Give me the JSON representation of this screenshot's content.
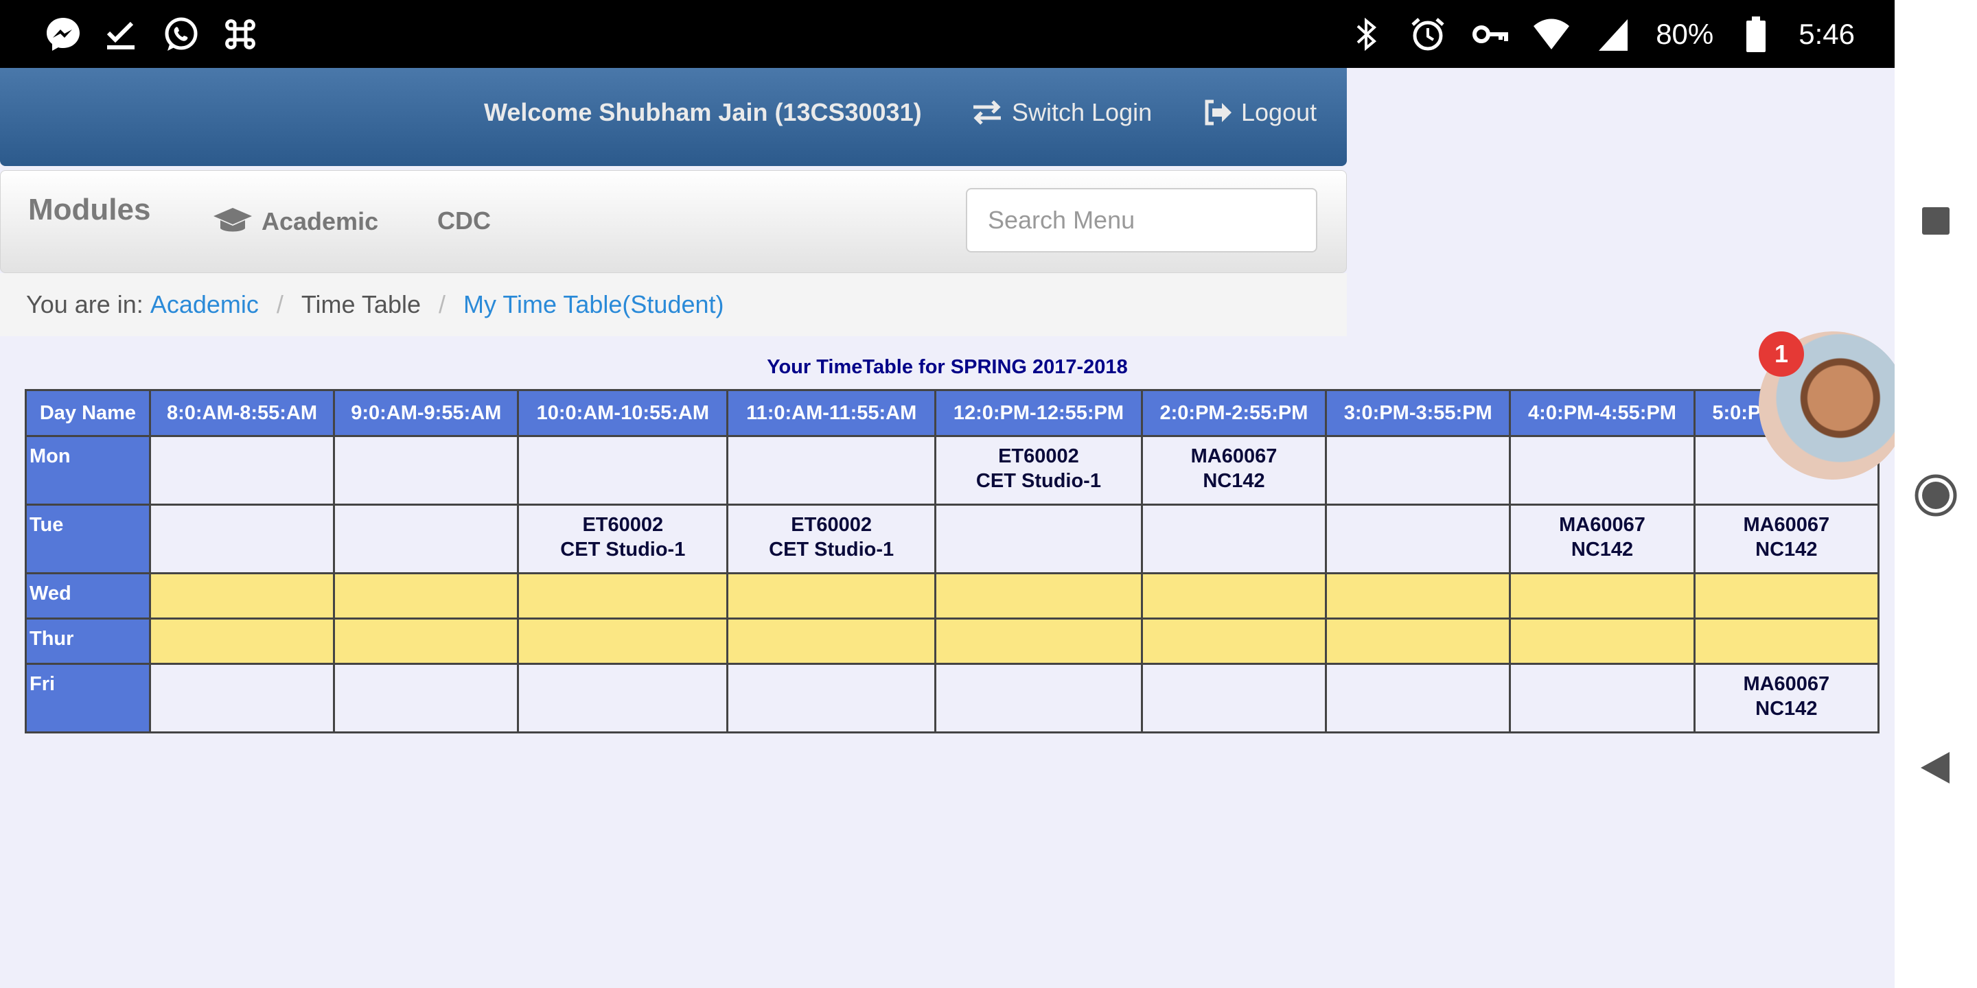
{
  "status_bar": {
    "left_icons": [
      "messenger-icon",
      "checkmark-icon",
      "whatsapp-icon",
      "command-icon"
    ],
    "right_icons": [
      "bluetooth-icon",
      "alarm-icon",
      "vpn-key-icon",
      "wifi-icon",
      "signal-icon",
      "battery-icon"
    ],
    "battery": "80%",
    "time": "5:46"
  },
  "header": {
    "welcome": "Welcome Shubham Jain (13CS30031)",
    "switch_login": "Switch Login",
    "logout": "Logout"
  },
  "modules": {
    "label": "Modules",
    "academic": "Academic",
    "cdc": "CDC",
    "search_placeholder": "Search Menu"
  },
  "breadcrumb": {
    "prefix": "You are in:",
    "items": [
      "Academic",
      "Time Table",
      "My Time Table(Student)"
    ]
  },
  "timetable": {
    "title": "Your TimeTable for SPRING 2017-2018",
    "headers": [
      "Day Name",
      "8:0:AM-8:55:AM",
      "9:0:AM-9:55:AM",
      "10:0:AM-10:55:AM",
      "11:0:AM-11:55:AM",
      "12:0:PM-12:55:PM",
      "2:0:PM-2:55:PM",
      "3:0:PM-3:55:PM",
      "4:0:PM-4:55:PM",
      "5:0:PM-5:55:PM"
    ],
    "rows": [
      {
        "day": "Mon",
        "holiday": false,
        "cells": [
          {
            "code": "",
            "room": ""
          },
          {
            "code": "",
            "room": ""
          },
          {
            "code": "",
            "room": ""
          },
          {
            "code": "",
            "room": ""
          },
          {
            "code": "ET60002",
            "room": "CET Studio-1"
          },
          {
            "code": "MA60067",
            "room": "NC142"
          },
          {
            "code": "",
            "room": ""
          },
          {
            "code": "",
            "room": ""
          },
          {
            "code": "",
            "room": ""
          }
        ]
      },
      {
        "day": "Tue",
        "holiday": false,
        "cells": [
          {
            "code": "",
            "room": ""
          },
          {
            "code": "",
            "room": ""
          },
          {
            "code": "ET60002",
            "room": "CET Studio-1"
          },
          {
            "code": "ET60002",
            "room": "CET Studio-1"
          },
          {
            "code": "",
            "room": ""
          },
          {
            "code": "",
            "room": ""
          },
          {
            "code": "",
            "room": ""
          },
          {
            "code": "MA60067",
            "room": "NC142"
          },
          {
            "code": "MA60067",
            "room": "NC142"
          }
        ]
      },
      {
        "day": "Wed",
        "holiday": true,
        "cells": [
          {
            "code": "",
            "room": ""
          },
          {
            "code": "",
            "room": ""
          },
          {
            "code": "",
            "room": ""
          },
          {
            "code": "",
            "room": ""
          },
          {
            "code": "",
            "room": ""
          },
          {
            "code": "",
            "room": ""
          },
          {
            "code": "",
            "room": ""
          },
          {
            "code": "",
            "room": ""
          },
          {
            "code": "",
            "room": ""
          }
        ]
      },
      {
        "day": "Thur",
        "holiday": true,
        "cells": [
          {
            "code": "",
            "room": ""
          },
          {
            "code": "",
            "room": ""
          },
          {
            "code": "",
            "room": ""
          },
          {
            "code": "",
            "room": ""
          },
          {
            "code": "",
            "room": ""
          },
          {
            "code": "",
            "room": ""
          },
          {
            "code": "",
            "room": ""
          },
          {
            "code": "",
            "room": ""
          },
          {
            "code": "",
            "room": ""
          }
        ]
      },
      {
        "day": "Fri",
        "holiday": false,
        "cells": [
          {
            "code": "",
            "room": ""
          },
          {
            "code": "",
            "room": ""
          },
          {
            "code": "",
            "room": ""
          },
          {
            "code": "",
            "room": ""
          },
          {
            "code": "",
            "room": ""
          },
          {
            "code": "",
            "room": ""
          },
          {
            "code": "",
            "room": ""
          },
          {
            "code": "",
            "room": ""
          },
          {
            "code": "MA60067",
            "room": "NC142"
          }
        ]
      }
    ]
  },
  "chat_head": {
    "badge": "1"
  },
  "nav_bar": {
    "icons": [
      "recents-icon",
      "home-icon",
      "back-icon"
    ]
  },
  "colors": {
    "header_blue": "#2c5a8c",
    "table_header": "#5578d8",
    "holiday_yellow": "#fbe784",
    "link_blue": "#2a8ad8",
    "title_navy": "#000088"
  }
}
